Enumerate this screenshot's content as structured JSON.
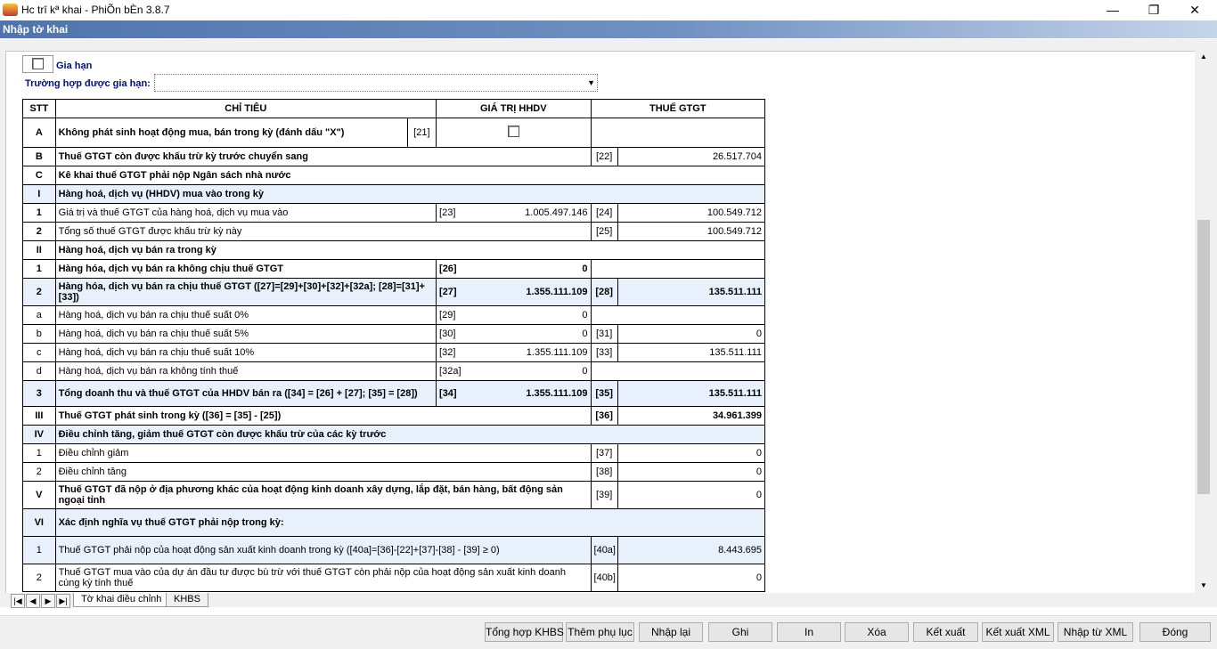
{
  "window": {
    "title": "Hc trî kª khai - PhiÕn bÈn 3.8.7",
    "minimize": "—",
    "restore": "❐",
    "close": "✕"
  },
  "header": {
    "title": "Nhập tờ khai"
  },
  "form": {
    "extension_label": "Gia hạn",
    "extension_case_label": "Trường hợp được gia hạn:",
    "extension_case_value": ""
  },
  "table": {
    "headers": [
      "STT",
      "CHỈ TIÊU",
      "GIÁ TRỊ HHDV",
      "THUẾ GTGT"
    ],
    "rows": [
      {
        "stt": "A",
        "label": "Không phát sinh hoạt động mua, bán trong kỳ (đánh dấu \"X\")",
        "c1": "[21]"
      },
      {
        "stt": "B",
        "label": "Thuế GTGT còn được khấu trừ kỳ trước chuyển sang",
        "c2": "[22]",
        "v2": "26.517.704"
      },
      {
        "stt": "C",
        "label": "Kê khai thuế GTGT phải nộp Ngân sách nhà nước"
      },
      {
        "stt": "I",
        "label": "Hàng hoá, dịch vụ (HHDV) mua vào trong kỳ"
      },
      {
        "stt": "1",
        "label": "Giá trị và thuế GTGT của hàng hoá, dịch vụ mua vào",
        "c1": "[23]",
        "v1": "1.005.497.146",
        "c2": "[24]",
        "v2": "100.549.712"
      },
      {
        "stt": "2",
        "label": "Tổng số thuế GTGT  được khấu trừ kỳ này",
        "c2": "[25]",
        "v2": "100.549.712"
      },
      {
        "stt": "II",
        "label": "Hàng hoá, dịch vụ bán ra trong kỳ"
      },
      {
        "stt": "1",
        "label": "Hàng hóa, dịch vụ bán ra không chịu thuế GTGT",
        "c1": "[26]",
        "v1": "0"
      },
      {
        "stt": "2",
        "label": "Hàng hóa, dịch vụ bán ra chịu thuế GTGT ([27]=[29]+[30]+[32]+[32a]; [28]=[31]+[33])",
        "c1": "[27]",
        "v1": "1.355.111.109",
        "c2": "[28]",
        "v2": "135.511.111"
      },
      {
        "stt": "a",
        "label": "Hàng hoá, dịch vụ bán ra chịu thuế suất 0%",
        "c1": "[29]",
        "v1": "0"
      },
      {
        "stt": "b",
        "label": "Hàng hoá, dịch vụ bán ra chịu thuế suất 5%",
        "c1": "[30]",
        "v1": "0",
        "c2": "[31]",
        "v2": "0"
      },
      {
        "stt": "c",
        "label": "Hàng hoá, dịch vụ bán ra chịu thuế suất 10%",
        "c1": "[32]",
        "v1": "1.355.111.109",
        "c2": "[33]",
        "v2": "135.511.111"
      },
      {
        "stt": "d",
        "label": "Hàng hoá, dịch vụ bán ra không tính thuế",
        "c1": "[32a]",
        "v1": "0"
      },
      {
        "stt": "3",
        "label": "Tổng doanh thu và thuế GTGT của HHDV bán  ra ([34] = [26] + [27]; [35] = [28])",
        "c1": "[34]",
        "v1": "1.355.111.109",
        "c2": "[35]",
        "v2": "135.511.111"
      },
      {
        "stt": "III",
        "label": "Thuế GTGT phát sinh trong kỳ ([36] = [35] - [25])",
        "c2": "[36]",
        "v2": "34.961.399"
      },
      {
        "stt": "IV",
        "label": "Điều chỉnh tăng, giảm thuế GTGT còn được khấu trừ của các kỳ trước"
      },
      {
        "stt": "1",
        "label": "Điều chỉnh giảm",
        "c2": "[37]",
        "v2": "0"
      },
      {
        "stt": "2",
        "label": "Điều chỉnh tăng",
        "c2": "[38]",
        "v2": "0"
      },
      {
        "stt": "V",
        "label": "Thuế GTGT đã nộp ở địa phương khác của hoạt động kinh doanh xây dựng, lắp đặt, bán hàng, bất động sản ngoại tỉnh",
        "c2": "[39]",
        "v2": "0"
      },
      {
        "stt": "VI",
        "label": "Xác định nghĩa vụ thuế GTGT phải nộp trong kỳ:"
      },
      {
        "stt": "1",
        "label": "Thuế GTGT phải nộp của hoạt động sản xuất kinh doanh trong kỳ ([40a]=[36]-[22]+[37]-[38] - [39] ≥ 0)",
        "c2": "[40a]",
        "v2": "8.443.695"
      },
      {
        "stt": "2",
        "label": "Thuế GTGT mua vào của dự án đầu tư được bù trừ với thuế GTGT còn phải nộp của hoạt động sản xuất kinh doanh cùng kỳ tính thuế",
        "c2": "[40b]",
        "v2": "0"
      }
    ]
  },
  "sheet_tabs": [
    "Tờ khai điều chỉnh",
    "KHBS"
  ],
  "buttons": [
    "Tổng hợp KHBS",
    "Thêm phụ lục",
    "Nhập lại",
    "Ghi",
    "In",
    "Xóa",
    "Kết xuất",
    "Kết xuất XML",
    "Nhập từ XML",
    "Đóng"
  ],
  "colors": {
    "header_band": "#4f74ad",
    "highlight_row": "#e7f0fb",
    "label_text": "#00127a"
  }
}
